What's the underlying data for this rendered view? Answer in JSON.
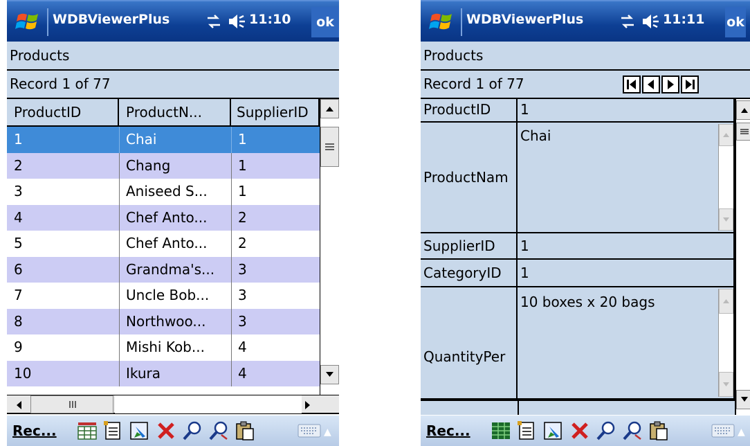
{
  "left": {
    "app_title": "WDBViewerPlus",
    "time": "11:10",
    "ok_label": "ok",
    "table_name": "Products",
    "record_status": "Record 1 of 77",
    "columns": [
      "ProductID",
      "ProductN...",
      "SupplierID"
    ],
    "rows": [
      [
        "1",
        "Chai",
        "1"
      ],
      [
        "2",
        "Chang",
        "1"
      ],
      [
        "3",
        "Aniseed S...",
        "1"
      ],
      [
        "4",
        "Chef Anto...",
        "2"
      ],
      [
        "5",
        "Chef Anto...",
        "2"
      ],
      [
        "6",
        "Grandma's...",
        "3"
      ],
      [
        "7",
        "Uncle Bob...",
        "3"
      ],
      [
        "8",
        "Northwoo...",
        "3"
      ],
      [
        "9",
        "Mishi Kob...",
        "4"
      ],
      [
        "10",
        "Ikura",
        "4"
      ]
    ],
    "menu_label": "Rec..."
  },
  "right": {
    "app_title": "WDBViewerPlus",
    "time": "11:11",
    "ok_label": "ok",
    "table_name": "Products",
    "record_status": "Record 1 of 77",
    "fields": {
      "product_id": {
        "label": "ProductID",
        "value": "1"
      },
      "product_name": {
        "label": "ProductNam",
        "value": "Chai"
      },
      "supplier_id": {
        "label": "SupplierID",
        "value": "1"
      },
      "category_id": {
        "label": "CategoryID",
        "value": "1"
      },
      "quantity": {
        "label": "QuantityPer",
        "value": "10 boxes x 20 bags"
      }
    },
    "menu_label": "Rec..."
  },
  "colors": {
    "titlebar": "#0d3f94",
    "header_bg": "#c8d8ea",
    "row_alt": "#ccccf4",
    "row_selected": "#3f8bd8"
  }
}
